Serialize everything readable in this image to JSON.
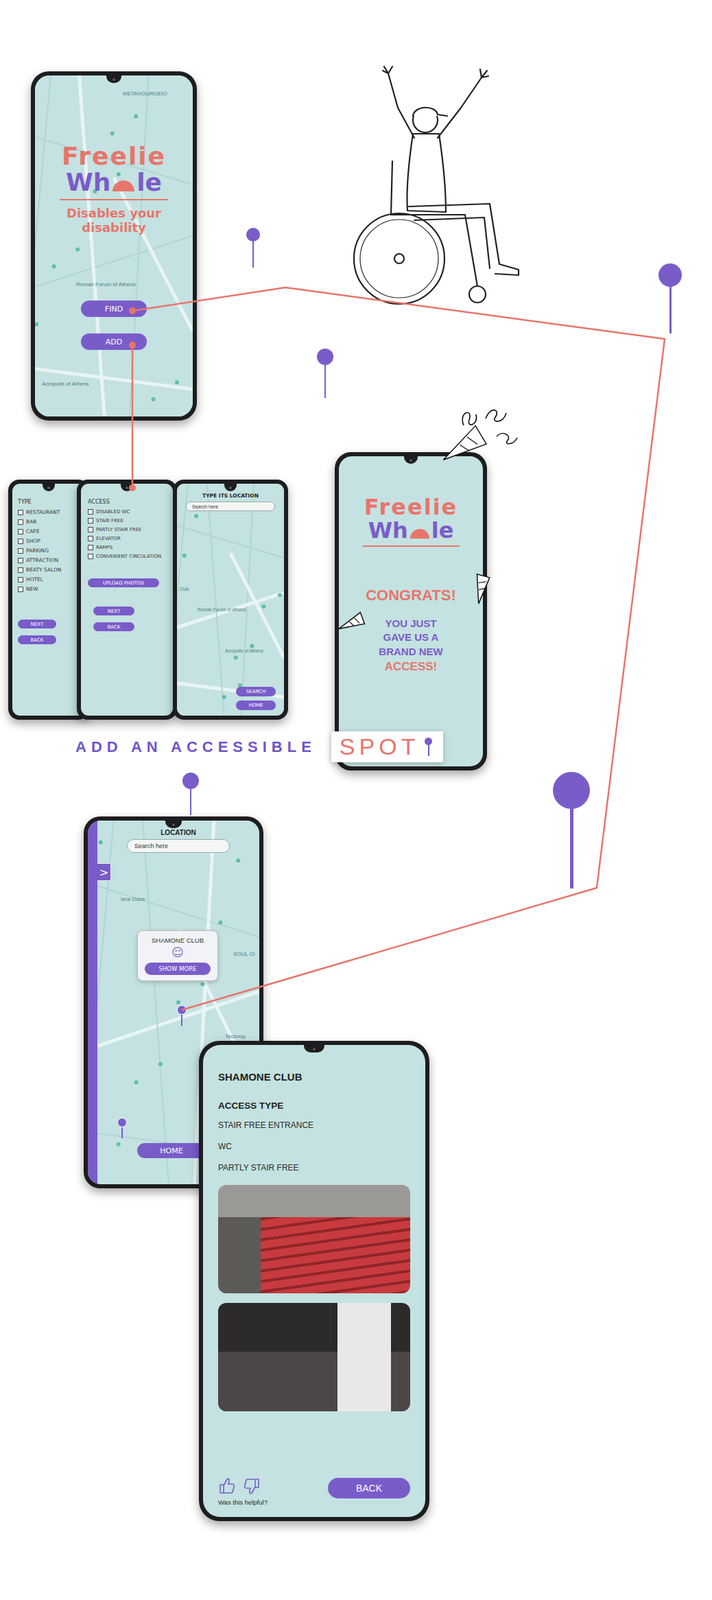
{
  "home": {
    "logo": {
      "top": "Freelie",
      "bottom_left": "Wh",
      "bottom_right": "le"
    },
    "tagline": "Disables your disability",
    "buttons": [
      "FIND",
      "ADD"
    ],
    "map_labels": [
      "Roman Forum of Athens",
      "Acropolis of Athens",
      "METAXOURGEIO"
    ]
  },
  "add_flow": {
    "type_screen": {
      "title": "TYPE",
      "options": [
        {
          "label": "RESTAURANT",
          "checked": false
        },
        {
          "label": "BAR",
          "checked": false
        },
        {
          "label": "CAFE",
          "checked": false
        },
        {
          "label": "SHOP",
          "checked": false
        },
        {
          "label": "PARKING",
          "checked": false
        },
        {
          "label": "ATTRACTION",
          "checked": false
        },
        {
          "label": "BEATY SALON",
          "checked": false
        },
        {
          "label": "HOTEL",
          "checked": false
        },
        {
          "label": "NEW",
          "checked": false
        }
      ],
      "buttons": [
        "NEXT",
        "BACK"
      ]
    },
    "access_screen": {
      "title": "ACCESS",
      "options": [
        {
          "label": "DISABLED WC",
          "checked": false
        },
        {
          "label": "STAIR FREE",
          "checked": false
        },
        {
          "label": "PARTLY STAIR FREE",
          "checked": false
        },
        {
          "label": "ELEVATOR",
          "checked": false
        },
        {
          "label": "RAMPS",
          "checked": false
        },
        {
          "label": "CONVENIENT CIRCULATION",
          "checked": false
        }
      ],
      "upload": "UPLOAD PHOTOS",
      "buttons": [
        "NEXT",
        "BACK"
      ]
    },
    "location_screen": {
      "title": "TYPE ITS LOCATION",
      "search_placeholder": "Search here",
      "map_labels": [
        "Roman Forum of Athens",
        "Acropolis of Athens",
        "Club"
      ],
      "buttons": [
        "SEARCH",
        "HOME"
      ]
    },
    "caption": {
      "text": "ADD AN ACCESSIBLE",
      "highlight": "SPOT"
    }
  },
  "congrats": {
    "logo": {
      "top": "Freelie",
      "bottom_left": "Wh",
      "bottom_right": "le"
    },
    "title": "CONGRATS!",
    "message": [
      "YOU JUST",
      "GAVE US A",
      "BRAND NEW"
    ],
    "accent": "ACCESS!"
  },
  "find_flow": {
    "map_screen": {
      "title": "LOCATION",
      "search_placeholder": "Search here",
      "side_toggle": ">",
      "popup": {
        "name": "SHAMONE CLUB",
        "face": "☺",
        "button": "SHOW MORE"
      },
      "map_labels": [
        "Iera Odos",
        "SOUL Cl",
        "Technop"
      ],
      "home": "HOME"
    },
    "detail_screen": {
      "name": "SHAMONE CLUB",
      "section": "ACCESS TYPE",
      "access_types": [
        "STAIR FREE ENTRANCE",
        "WC",
        "PARTLY STAIR FREE"
      ],
      "photos": [
        {
          "kind": "stairs"
        },
        {
          "kind": "restroom"
        }
      ],
      "feedback": "Was this helpful?",
      "back": "BACK"
    }
  }
}
